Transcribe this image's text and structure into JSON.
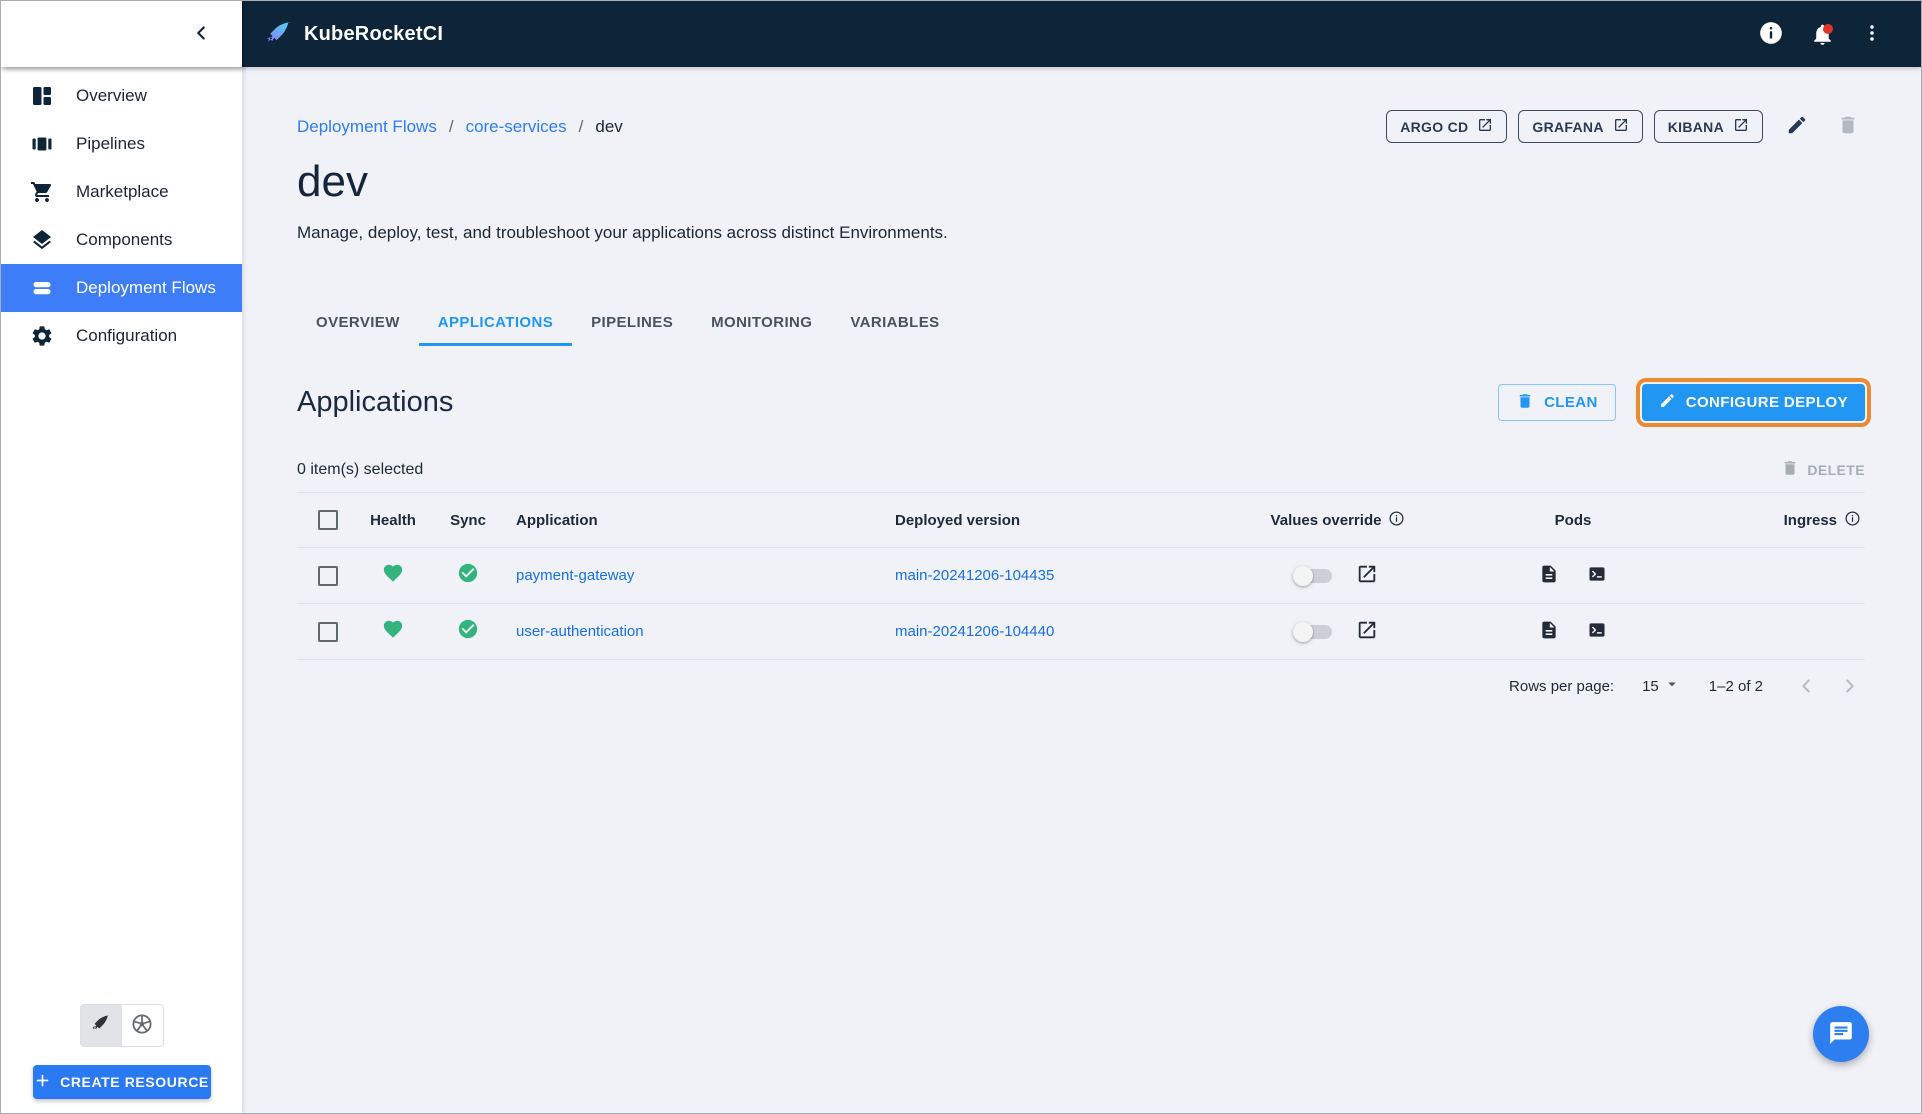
{
  "colors": {
    "header_navy": "#0e2439",
    "accent_blue": "#2196f3",
    "sidebar_selected_blue": "#3d7ef8",
    "success_green": "#34b37e",
    "highlight_orange": "#ea8a33",
    "link_blue": "#1a6fe0",
    "page_background": "#f0f2f8"
  },
  "header": {
    "brand": "KubeRocketCI",
    "icons": [
      "rocket-logo-icon",
      "info-icon",
      "notifications-icon",
      "kebab-menu-icon",
      "collapse-chevron-icon"
    ]
  },
  "sidebar": {
    "items": [
      {
        "label": "Overview",
        "icon": "dashboard-icon",
        "active": false
      },
      {
        "label": "Pipelines",
        "icon": "pipelines-icon",
        "active": false
      },
      {
        "label": "Marketplace",
        "icon": "cart-icon",
        "active": false
      },
      {
        "label": "Components",
        "icon": "layers-icon",
        "active": false
      },
      {
        "label": "Deployment Flows",
        "icon": "flows-icon",
        "active": true
      },
      {
        "label": "Configuration",
        "icon": "gear-icon",
        "active": false
      }
    ],
    "view_toggle": [
      "kuberocketci-view-icon",
      "kubernetes-view-icon"
    ],
    "create_button_label": "CREATE RESOURCE"
  },
  "breadcrumb": {
    "links": [
      "Deployment Flows",
      "core-services"
    ],
    "current": "dev",
    "separator": "/"
  },
  "page": {
    "title": "dev",
    "description": "Manage, deploy, test, and troubleshoot your applications across distinct Environments."
  },
  "quick_links": [
    "ARGO CD",
    "GRAFANA",
    "KIBANA"
  ],
  "tabs": [
    "OVERVIEW",
    "APPLICATIONS",
    "PIPELINES",
    "MONITORING",
    "VARIABLES"
  ],
  "active_tab": "APPLICATIONS",
  "applications": {
    "heading": "Applications",
    "clean_label": "CLEAN",
    "configure_label": "CONFIGURE DEPLOY",
    "selected_text": "0 item(s) selected",
    "delete_label": "DELETE",
    "columns": [
      "Health",
      "Sync",
      "Application",
      "Deployed version",
      "Values override",
      "Pods",
      "Ingress"
    ],
    "rows": [
      {
        "application": "payment-gateway",
        "deployed_version": "main-20241206-104435",
        "health": "healthy",
        "sync": "synced",
        "values_override": "off"
      },
      {
        "application": "user-authentication",
        "deployed_version": "main-20241206-104440",
        "health": "healthy",
        "sync": "synced",
        "values_override": "off"
      }
    ],
    "pagination": {
      "rows_per_page_label": "Rows per page:",
      "rows_per_page": "15",
      "range": "1–2 of 2"
    }
  }
}
